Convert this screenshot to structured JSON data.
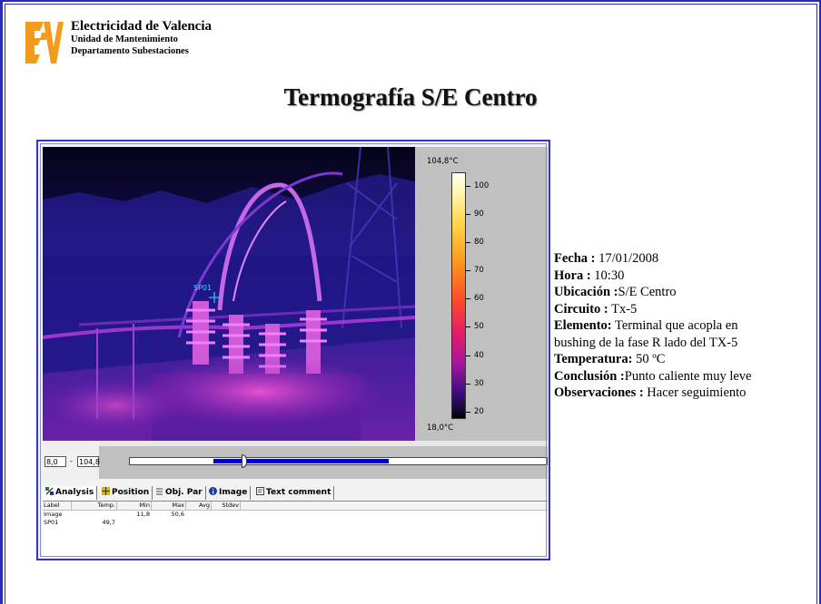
{
  "header": {
    "logo_icon": "ev-logo",
    "org_name": "Electricidad de Valencia",
    "unit": "Unidad de Mantenimiento",
    "department": "Departamento Subestaciones",
    "brand_color": "#f39c1c"
  },
  "title": "Termografía S/E Centro",
  "thermal_image": {
    "spot_label": "SP01",
    "scale": {
      "max_label": "104,8°C",
      "min_label": "18,0°C",
      "max": 104.8,
      "min": 18.0,
      "ticks": [
        "100",
        "90",
        "80",
        "70",
        "60",
        "50",
        "40",
        "30",
        "20"
      ]
    },
    "range": {
      "low": "8,0",
      "separator": "-",
      "high": "104,8",
      "fill_start_fraction": 0.2,
      "fill_end_fraction": 0.62
    },
    "tabs": [
      {
        "label": "Analysis",
        "icon": "analysis-icon"
      },
      {
        "label": "Position",
        "icon": "position-icon"
      },
      {
        "label": "Obj. Par",
        "icon": "object-parameters-icon"
      },
      {
        "label": "Image",
        "icon": "info-icon"
      },
      {
        "label": "Text comment",
        "icon": "text-comment-icon"
      }
    ],
    "table": {
      "columns": [
        "Label",
        "Temp.",
        "Min",
        "Max",
        "Avg",
        "Stdev"
      ],
      "rows": [
        {
          "label": "Image",
          "temp": "",
          "min": "11,8",
          "max": "50,6",
          "avg": "",
          "stdev": ""
        },
        {
          "label": "SP01",
          "temp": "49,7",
          "min": "",
          "max": "",
          "avg": "",
          "stdev": ""
        }
      ]
    }
  },
  "info": {
    "fecha_label": "Fecha :",
    "fecha_value": "17/01/2008",
    "hora_label": "Hora :",
    "hora_value": "10:30",
    "ubicacion_label": "Ubicación :",
    "ubicacion_value": "S/E  Centro",
    "circuito_label": "Circuito :",
    "circuito_value": "Tx-5",
    "elemento_label": "Elemento:",
    "elemento_value_1": "Terminal que acopla en",
    "elemento_value_2": "bushing de la fase R lado del TX-5",
    "temperatura_label": "Temperatura:",
    "temperatura_value": "50 ºC",
    "conclusion_label": "Conclusión :",
    "conclusion_value": "Punto caliente muy leve",
    "observaciones_label": "Observaciones :",
    "observaciones_value": "Hacer seguimiento"
  }
}
